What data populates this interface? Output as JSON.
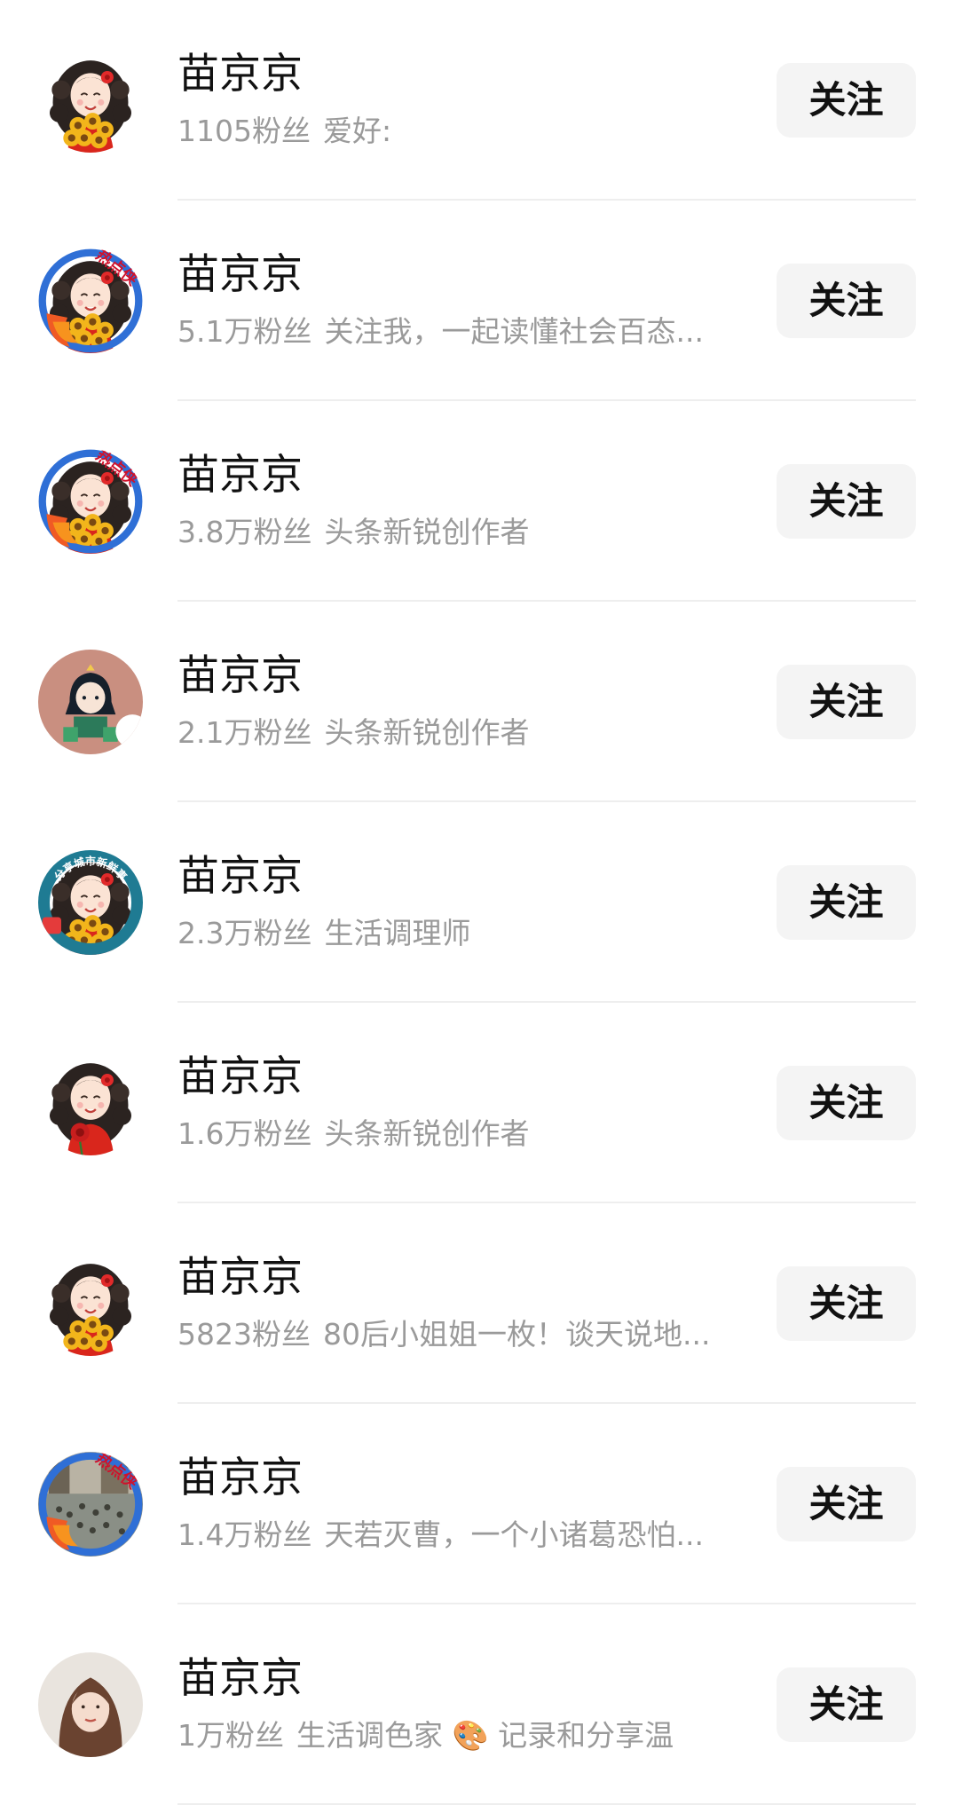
{
  "follow_label": "关注",
  "users": [
    {
      "name": "苗京京",
      "fans": "1105粉丝",
      "bio": "爱好:",
      "avatar": "sunflower-girl",
      "ring": "none"
    },
    {
      "name": "苗京京",
      "fans": "5.1万粉丝",
      "bio": "关注我，一起读懂社会百态...",
      "avatar": "sunflower-girl",
      "ring": "hot",
      "badge_text": "热点侠"
    },
    {
      "name": "苗京京",
      "fans": "3.8万粉丝",
      "bio": "头条新锐创作者",
      "avatar": "sunflower-girl",
      "ring": "hot",
      "badge_text": "热点侠"
    },
    {
      "name": "苗京京",
      "fans": "2.1万粉丝",
      "bio": "头条新锐创作者",
      "avatar": "cartoon-girl",
      "ring": "none"
    },
    {
      "name": "苗京京",
      "fans": "2.3万粉丝",
      "bio": "生活调理师",
      "avatar": "sunflower-girl",
      "ring": "city",
      "badge_text": "分享城市新鲜事"
    },
    {
      "name": "苗京京",
      "fans": "1.6万粉丝",
      "bio": "头条新锐创作者",
      "avatar": "rose-girl",
      "ring": "none"
    },
    {
      "name": "苗京京",
      "fans": "5823粉丝",
      "bio": "80后小姐姐一枚！谈天说地...",
      "avatar": "sunflower-girl",
      "ring": "none"
    },
    {
      "name": "苗京京",
      "fans": "1.4万粉丝",
      "bio": "天若灭曹，一个小诸葛恐怕...",
      "avatar": "crowd-photo",
      "ring": "hot",
      "badge_text": "热点侠"
    },
    {
      "name": "苗京京",
      "fans": "1万粉丝",
      "bio": "生活调色家 🎨 记录和分享温",
      "avatar": "woman-photo",
      "ring": "none"
    }
  ],
  "colors": {
    "name_text": "#111111",
    "sub_text": "#9a9a9a",
    "button_bg": "#f4f4f4",
    "divider": "#eeeeee",
    "hot_ring": "#2f6fd6",
    "hot_badge_text": "#d0112b",
    "city_ring": "#1f7b93"
  }
}
